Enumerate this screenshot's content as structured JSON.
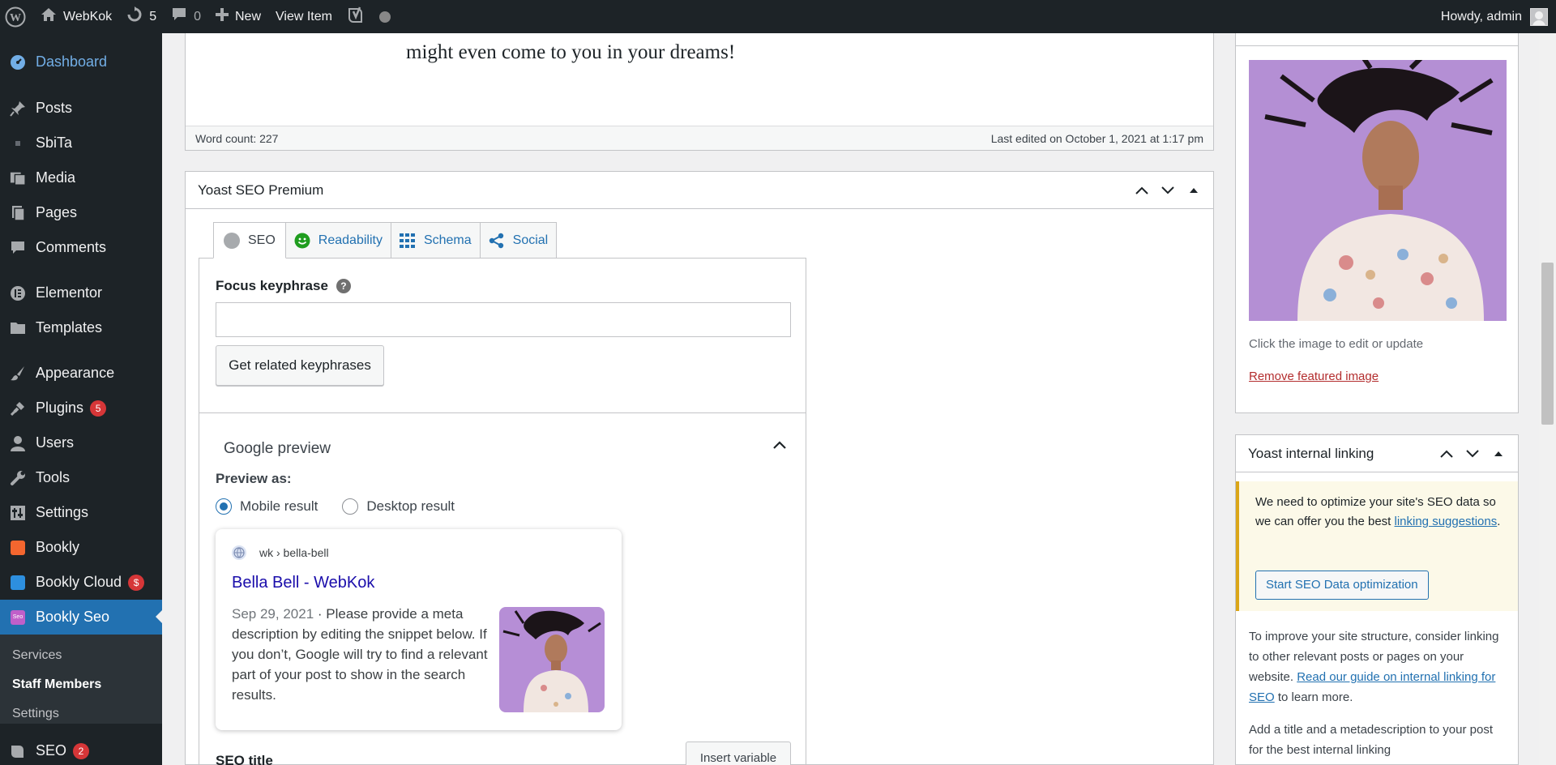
{
  "adminbar": {
    "site_name": "WebKok",
    "updates_count": "5",
    "comments_count": "0",
    "new_label": "New",
    "view_item_label": "View Item",
    "greeting": "Howdy, admin"
  },
  "sidebar": {
    "items": [
      {
        "label": "Dashboard",
        "icon": "dashboard-icon"
      },
      {
        "label": "Posts",
        "icon": "pin-icon"
      },
      {
        "label": "SbiTa",
        "icon": "plugin-icon"
      },
      {
        "label": "Media",
        "icon": "media-icon"
      },
      {
        "label": "Pages",
        "icon": "pages-icon"
      },
      {
        "label": "Comments",
        "icon": "comments-icon"
      },
      {
        "label": "Elementor",
        "icon": "elementor-icon"
      },
      {
        "label": "Templates",
        "icon": "folder-icon"
      },
      {
        "label": "Appearance",
        "icon": "brush-icon"
      },
      {
        "label": "Plugins",
        "icon": "plug-icon",
        "badge": "5"
      },
      {
        "label": "Users",
        "icon": "user-icon"
      },
      {
        "label": "Tools",
        "icon": "wrench-icon"
      },
      {
        "label": "Settings",
        "icon": "settings-icon"
      },
      {
        "label": "Bookly",
        "icon": "bookly-icon"
      },
      {
        "label": "Bookly Cloud",
        "icon": "cloud-icon",
        "badge": "$"
      },
      {
        "label": "Bookly Seo",
        "icon": "seo-icon"
      },
      {
        "label": "SEO",
        "icon": "yoast-icon",
        "badge": "2"
      }
    ],
    "submenu": [
      "Services",
      "Staff Members",
      "Settings"
    ]
  },
  "editor": {
    "dream_text": "might even come to you in your dreams!",
    "word_count": "Word count: 227",
    "last_edited": "Last edited on October 1, 2021 at 1:17 pm"
  },
  "yoast": {
    "title": "Yoast SEO Premium",
    "tabs": [
      "SEO",
      "Readability",
      "Schema",
      "Social"
    ],
    "focus_keyphrase_label": "Focus keyphrase",
    "focus_keyphrase_value": "",
    "related_button": "Get related keyphrases",
    "google_preview_title": "Google preview",
    "preview_as_label": "Preview as:",
    "radio_mobile": "Mobile result",
    "radio_desktop": "Desktop result",
    "snippet": {
      "url": "wk › bella-bell",
      "title": "Bella Bell - WebKok",
      "date": "Sep 29, 2021",
      "description": "Please provide a meta description by editing the snippet below. If you don’t, Google will try to find a relevant part of your post to show in the search results."
    },
    "seo_title_label": "SEO title",
    "insert_variable": "Insert variable"
  },
  "featured": {
    "caption": "Click the image to edit or update",
    "remove_link": "Remove featured image"
  },
  "linking": {
    "title": "Yoast internal linking",
    "notice_text": "We need to optimize your site's SEO data so we can offer you the best ",
    "notice_link": "linking suggestions",
    "start_button": "Start SEO Data optimization",
    "para1_text": "To improve your site structure, consider linking to other relevant posts or pages on your website. ",
    "para1_link": "Read our guide on internal linking for SEO",
    "para1_end": " to learn more.",
    "para2_text": "Add a title and a metadescription to your post for the best internal linking"
  },
  "colors": {
    "admin_dark": "#1d2327",
    "accent_blue": "#2271b1",
    "badge_red": "#d63638",
    "notice_yellow": "#dba617"
  }
}
